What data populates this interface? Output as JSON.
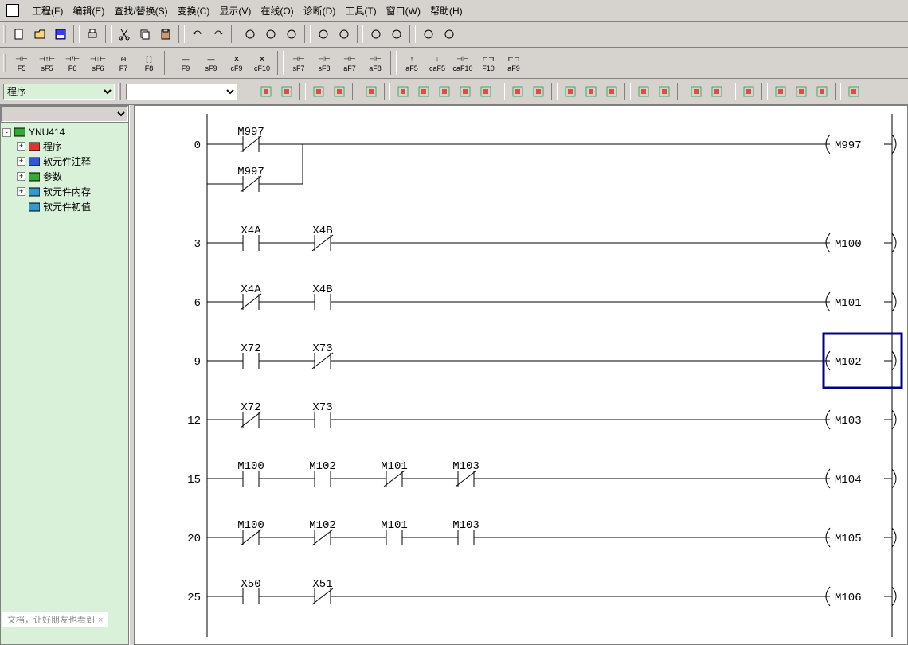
{
  "menu": {
    "items": [
      {
        "label": "工程(F)"
      },
      {
        "label": "编辑(E)"
      },
      {
        "label": "查找/替换(S)"
      },
      {
        "label": "变换(C)"
      },
      {
        "label": "显示(V)"
      },
      {
        "label": "在线(O)"
      },
      {
        "label": "诊断(D)"
      },
      {
        "label": "工具(T)"
      },
      {
        "label": "窗口(W)"
      },
      {
        "label": "帮助(H)"
      }
    ]
  },
  "toolbar1": {
    "buttons": [
      {
        "name": "new-icon",
        "hint": "New"
      },
      {
        "name": "open-icon"
      },
      {
        "name": "save-icon"
      },
      {
        "sep": true
      },
      {
        "name": "print-icon"
      },
      {
        "sep": true
      },
      {
        "name": "cut-icon"
      },
      {
        "name": "copy-icon"
      },
      {
        "name": "paste-icon"
      },
      {
        "sep": true
      },
      {
        "name": "undo-icon"
      },
      {
        "name": "redo-icon"
      },
      {
        "sep": true
      },
      {
        "name": "zoom1-icon"
      },
      {
        "name": "zoom2-icon"
      },
      {
        "name": "zoom3-icon"
      },
      {
        "sep": true
      },
      {
        "name": "monitor1-icon"
      },
      {
        "name": "monitor2-icon"
      },
      {
        "sep": true
      },
      {
        "name": "write1-icon"
      },
      {
        "name": "write2-icon"
      },
      {
        "sep": true
      },
      {
        "name": "window-icon"
      },
      {
        "name": "refresh-icon"
      }
    ]
  },
  "symbols": {
    "buttons": [
      {
        "sym": "⊣⊢",
        "cap": "F5"
      },
      {
        "sym": "⊣↑⊢",
        "cap": "sF5"
      },
      {
        "sym": "⊣/⊢",
        "cap": "F6"
      },
      {
        "sym": "⊣↓⊢",
        "cap": "sF6"
      },
      {
        "sym": "⊖",
        "cap": "F7"
      },
      {
        "sym": "[ ]",
        "cap": "F8"
      },
      {
        "sep": true
      },
      {
        "sym": "—",
        "cap": "F9"
      },
      {
        "sym": "—",
        "cap": "sF9"
      },
      {
        "sym": "✕",
        "cap": "cF9"
      },
      {
        "sym": "✕",
        "cap": "cF10"
      },
      {
        "sep": true
      },
      {
        "sym": "⊣⊢",
        "cap": "sF7"
      },
      {
        "sym": "⊣⊢",
        "cap": "sF8"
      },
      {
        "sym": "⊣⊢",
        "cap": "aF7"
      },
      {
        "sym": "⊣⊢",
        "cap": "aF8"
      },
      {
        "sep": true
      },
      {
        "sym": "↑",
        "cap": "aF5"
      },
      {
        "sym": "↓",
        "cap": "caF5"
      },
      {
        "sym": "⊣⊢",
        "cap": "caF10"
      },
      {
        "sym": "⊏⊐",
        "cap": "F10"
      },
      {
        "sym": "⊏⊐",
        "cap": "aF9"
      }
    ]
  },
  "row3": {
    "left_select": "程序",
    "right_select": "",
    "icons": [
      "view-icon",
      "tree-icon",
      null,
      "t1",
      "t2",
      null,
      "t3",
      null,
      "r1",
      "r2",
      "r3",
      "r4",
      "r5",
      null,
      "r6",
      "r7",
      null,
      "r8",
      "r9",
      "r10",
      null,
      "r11",
      "r12",
      null,
      "r13",
      "r14",
      null,
      "r15",
      null,
      "r16",
      "r17",
      "r18",
      null,
      "r19"
    ]
  },
  "tree": {
    "root": "YNU414",
    "children": [
      {
        "icon": "red",
        "label": "程序",
        "exp": "+"
      },
      {
        "icon": "blue",
        "label": "软元件注释",
        "exp": "+"
      },
      {
        "icon": "green",
        "label": "参数",
        "exp": "+"
      },
      {
        "icon": "dev",
        "label": "软元件内存",
        "exp": "+"
      },
      {
        "icon": "dev",
        "label": "软元件初值",
        "exp": ""
      }
    ]
  },
  "ladder": {
    "selected_rung": 3,
    "rungs": [
      {
        "step": 0,
        "contacts": [
          {
            "type": "nc",
            "label": "M997"
          }
        ],
        "coil": "M997",
        "branch": {
          "contacts": [
            {
              "type": "nc",
              "label": "M997"
            }
          ]
        }
      },
      {
        "step": 3,
        "contacts": [
          {
            "type": "no",
            "label": "X4A"
          },
          {
            "type": "nc",
            "label": "X4B"
          }
        ],
        "coil": "M100"
      },
      {
        "step": 6,
        "contacts": [
          {
            "type": "nc",
            "label": "X4A"
          },
          {
            "type": "no",
            "label": "X4B"
          }
        ],
        "coil": "M101"
      },
      {
        "step": 9,
        "contacts": [
          {
            "type": "no",
            "label": "X72"
          },
          {
            "type": "nc",
            "label": "X73"
          }
        ],
        "coil": "M102"
      },
      {
        "step": 12,
        "contacts": [
          {
            "type": "nc",
            "label": "X72"
          },
          {
            "type": "no",
            "label": "X73"
          }
        ],
        "coil": "M103"
      },
      {
        "step": 15,
        "contacts": [
          {
            "type": "no",
            "label": "M100"
          },
          {
            "type": "no",
            "label": "M102"
          },
          {
            "type": "nc",
            "label": "M101"
          },
          {
            "type": "nc",
            "label": "M103"
          }
        ],
        "coil": "M104"
      },
      {
        "step": 20,
        "contacts": [
          {
            "type": "nc",
            "label": "M100"
          },
          {
            "type": "nc",
            "label": "M102"
          },
          {
            "type": "no",
            "label": "M101"
          },
          {
            "type": "no",
            "label": "M103"
          }
        ],
        "coil": "M105"
      },
      {
        "step": 25,
        "contacts": [
          {
            "type": "no",
            "label": "X50"
          },
          {
            "type": "nc",
            "label": "X51"
          }
        ],
        "coil": "M106"
      }
    ]
  },
  "status": {
    "text": "文档，让好朋友也看到"
  }
}
